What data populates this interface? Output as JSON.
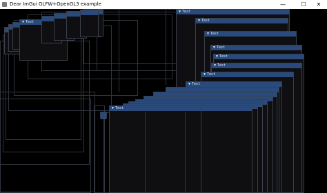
{
  "window": {
    "title": "Dear ImGui GLFW+OpenGL3 example",
    "minimize_glyph": "—",
    "maximize_glyph": "☐",
    "close_glyph": "✕"
  },
  "imgui": {
    "window_label": "Test",
    "collapse_arrow": "▼"
  }
}
